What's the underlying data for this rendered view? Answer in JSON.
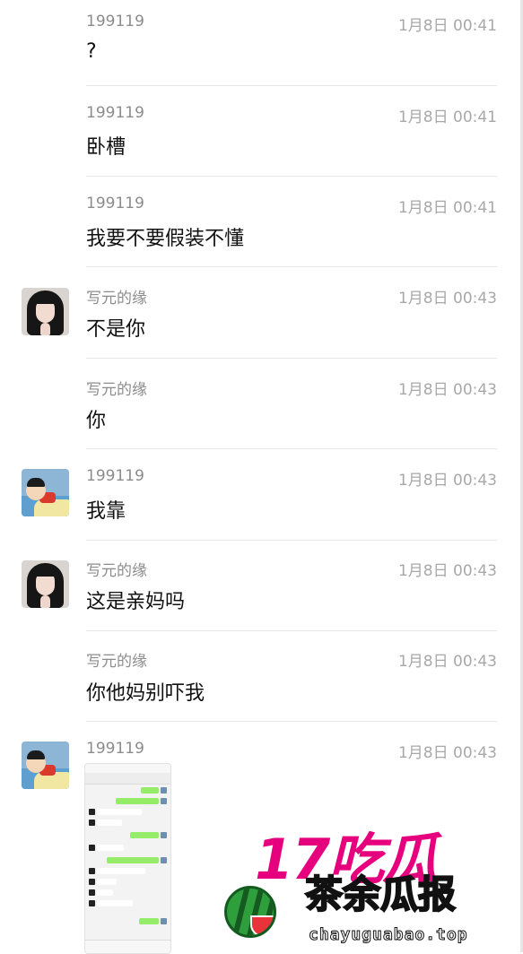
{
  "messages": [
    {
      "sender": "199119",
      "time": "1月8日 00:41",
      "text": "?",
      "avatar": "none"
    },
    {
      "sender": "199119",
      "time": "1月8日 00:41",
      "text": "卧槽",
      "avatar": "none"
    },
    {
      "sender": "199119",
      "time": "1月8日 00:41",
      "text": "我要不要假装不懂",
      "avatar": "none"
    },
    {
      "sender": "写元的缘",
      "time": "1月8日 00:43",
      "text": "不是你",
      "avatar": "girl-avatar"
    },
    {
      "sender": "写元的缘",
      "time": "1月8日 00:43",
      "text": "你",
      "avatar": "none"
    },
    {
      "sender": "199119",
      "time": "1月8日 00:43",
      "text": "我靠",
      "avatar": "cartoon-avatar"
    },
    {
      "sender": "写元的缘",
      "time": "1月8日 00:43",
      "text": "这是亲妈吗",
      "avatar": "girl-avatar"
    },
    {
      "sender": "写元的缘",
      "time": "1月8日 00:43",
      "text": "你他妈别吓我",
      "avatar": "none"
    },
    {
      "sender": "199119",
      "time": "1月8日 00:43",
      "text": "",
      "avatar": "cartoon-avatar",
      "attachment": "chat-screenshot-image"
    }
  ],
  "watermark": {
    "brand_big": "17吃瓜",
    "brand_sub": "茶余瓜报",
    "url": "chayuguabao.top"
  },
  "colors": {
    "sender_text": "#8c8c8c",
    "time_text": "#a8a8a8",
    "divider": "#e7e7e7",
    "watermark_pink": "#e6007e",
    "watermark_yellow": "#ffe600"
  }
}
